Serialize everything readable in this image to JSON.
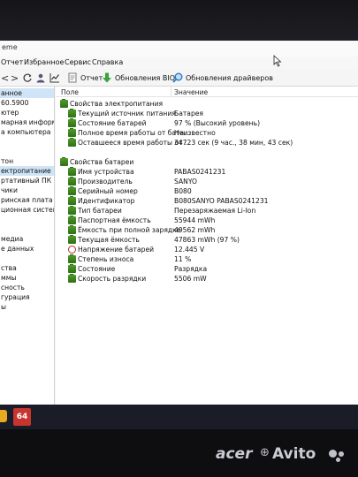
{
  "window": {
    "title_fragment": "eme"
  },
  "menu": [
    "Отчет",
    "Избранное",
    "Сервис",
    "Справка"
  ],
  "toolbar": {
    "report": "Отчет",
    "bios_updates": "Обновления BIOS",
    "driver_updates": "Обновления драйверов"
  },
  "tree": [
    "анное",
    "60.5900",
    "ютер",
    "марная информа",
    "а компьютера",
    "",
    "",
    "тон",
    "ектропитание",
    "ртативный ПК",
    "чики",
    "ринская плата",
    "ционная система",
    "",
    "",
    "медиа",
    "е данных",
    "",
    "ства",
    "ммы",
    "сность",
    "гурация",
    "ы"
  ],
  "table": {
    "col_field": "Поле",
    "col_value": "Значение",
    "groups": [
      {
        "title": "Свойства электропитания",
        "rows": [
          {
            "name": "Текущий источник питания",
            "value": "Батарея"
          },
          {
            "name": "Состояние батарей",
            "value": "97 % (Высокий уровень)"
          },
          {
            "name": "Полное время работы от бата...",
            "value": "Неизвестно"
          },
          {
            "name": "Оставшееся время работы от ...",
            "value": "34723 сек (9 час., 38 мин, 43 сек)"
          }
        ]
      },
      {
        "title": "Свойства батареи",
        "rows": [
          {
            "name": "Имя устройства",
            "value": "PABAS0241231"
          },
          {
            "name": "Производитель",
            "value": "SANYO"
          },
          {
            "name": "Серийный номер",
            "value": "B080"
          },
          {
            "name": "Идентификатор",
            "value": "B080SANYO PABAS0241231"
          },
          {
            "name": "Тип батареи",
            "value": "Перезаряжаемая Li-Ion"
          },
          {
            "name": "Паспортная ёмкость",
            "value": "55944 mWh"
          },
          {
            "name": "Ёмкость при полной зарядке",
            "value": "49562 mWh"
          },
          {
            "name": "Текущая ёмкость",
            "value": "47863 mWh  (97 %)"
          },
          {
            "name": "Напряжение батарей",
            "value": "12.445 V"
          },
          {
            "name": "Степень износа",
            "value": "11 %"
          },
          {
            "name": "Состояние",
            "value": "Разрядка"
          },
          {
            "name": "Скорость разрядки",
            "value": "5506 mW"
          }
        ]
      }
    ]
  },
  "taskbar": {
    "badge": "64"
  },
  "watermark": {
    "acer": "acer",
    "avito": "Avito"
  }
}
